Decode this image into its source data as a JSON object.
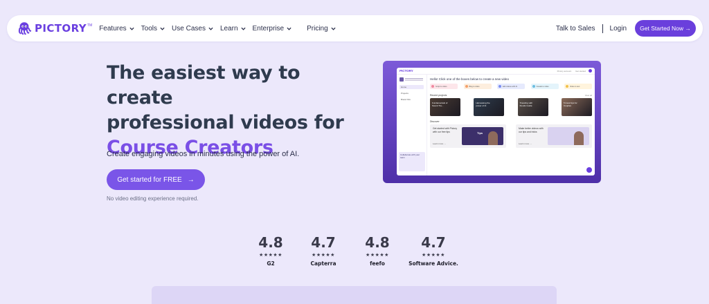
{
  "nav": {
    "logo_text": "PICTORY",
    "logo_tm": "TM",
    "menu": [
      "Features",
      "Tools",
      "Use Cases",
      "Learn",
      "Enterprise",
      "Pricing"
    ],
    "talk_to_sales": "Talk to Sales",
    "login": "Login",
    "cta": "Get Started Now →"
  },
  "hero": {
    "title_line1": "The easiest way to create",
    "title_line2": "professional videos for",
    "title_accent": "Course Creators",
    "subtitle": "Create engaging videos in minutes using the power of AI.",
    "cta_label": "Get started for FREE",
    "cta_arrow": "→",
    "note": "No video editing experience required."
  },
  "preview": {
    "logo": "PICTORY",
    "top_links": [
      "Pictory account",
      "Get started"
    ],
    "side_links": [
      "Home",
      "Projects",
      "Brand Kits"
    ],
    "promo_text": "Collaborate with your team",
    "hello": "Hello! Click one of the boxes below to create a new video",
    "quick": [
      {
        "label": "Script to video",
        "color": "#fde6ea",
        "dot": "#f08aa0"
      },
      {
        "label": "Blog to video",
        "color": "#fdeede",
        "dot": "#f4a06a"
      },
      {
        "label": "Edit videos with AI",
        "color": "#e6eafd",
        "dot": "#7b8df0"
      },
      {
        "label": "Visuals to video",
        "color": "#e4f4fb",
        "dot": "#6bbde0"
      },
      {
        "label": "Video to text",
        "color": "#fff4dd",
        "dot": "#f2c14a"
      }
    ],
    "recent_label": "Recent projects",
    "view_all": "View all",
    "thumbs": [
      {
        "text": "Fundamentals of Sound Tra...",
        "color": "#4a3b33"
      },
      {
        "text": "Harnessing the power of AI",
        "color": "#2e3d4d"
      },
      {
        "text": "Traveling with friends Guide",
        "color": "#5a5048"
      },
      {
        "text": "5 travel tips for Couples",
        "color": "#8a6a58"
      }
    ],
    "discover_label": "Discover",
    "discover": [
      {
        "text": "Get started with Pictory with our free tips",
        "learn": "Learn more →",
        "img": "#3c2f6a",
        "tag": "Tips"
      },
      {
        "text": "Make better videos with our tips and tricks",
        "learn": "Learn more →",
        "img": "#d9d2f0",
        "tag": ""
      }
    ]
  },
  "ratings": [
    {
      "score": "4.8",
      "stars": "★★★★★",
      "brand": "G2"
    },
    {
      "score": "4.7",
      "stars": "★★★★★",
      "brand": "Capterra"
    },
    {
      "score": "4.8",
      "stars": "★★★★★",
      "brand": "feefo"
    },
    {
      "score": "4.7",
      "stars": "★★★★★",
      "brand": "Software Advice."
    }
  ],
  "colors": {
    "brand": "#6a3fe0",
    "accent": "#7a4fe6",
    "background": "#ece8fb"
  }
}
